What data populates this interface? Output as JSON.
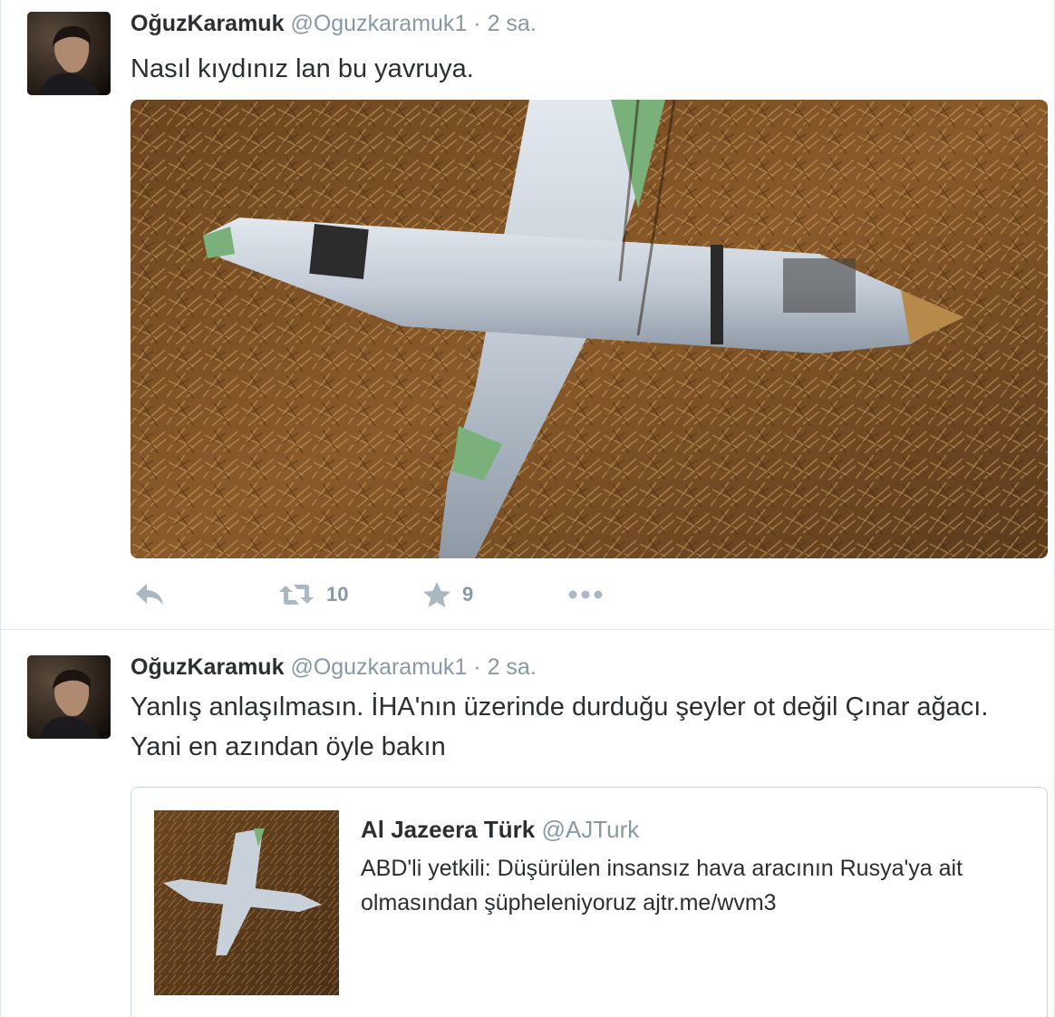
{
  "colors": {
    "text": "#292f33",
    "muted": "#8899a6",
    "icon": "#aab8c2",
    "border": "#e1e8ed"
  },
  "tweets": [
    {
      "fullname": "OğuzKaramuk",
      "username": "@Oguzkaramuk1",
      "separator": "·",
      "time": "2 sa.",
      "text": "Nasıl kıydınız lan bu yavruya.",
      "media": {
        "description_icon": "photo-drone-wreck"
      },
      "actions": {
        "reply_icon": "reply-icon",
        "retweet_icon": "retweet-icon",
        "retweet_count": "10",
        "favorite_icon": "star-icon",
        "favorite_count": "9",
        "more_icon": "more-icon"
      }
    },
    {
      "fullname": "OğuzKaramuk",
      "username": "@Oguzkaramuk1",
      "separator": "·",
      "time": "2 sa.",
      "text": "Yanlış anlaşılmasın. İHA'nın üzerinde durduğu şeyler ot değil Çınar ağacı. Yani en azından öyle bakın",
      "quote": {
        "fullname": "Al Jazeera Türk",
        "username": "@AJTurk",
        "text": "ABD'li yetkili: Düşürülen insansız hava aracının Rusya'ya ait olmasından şüpheleniyoruz ajtr.me/wvm3"
      }
    }
  ]
}
